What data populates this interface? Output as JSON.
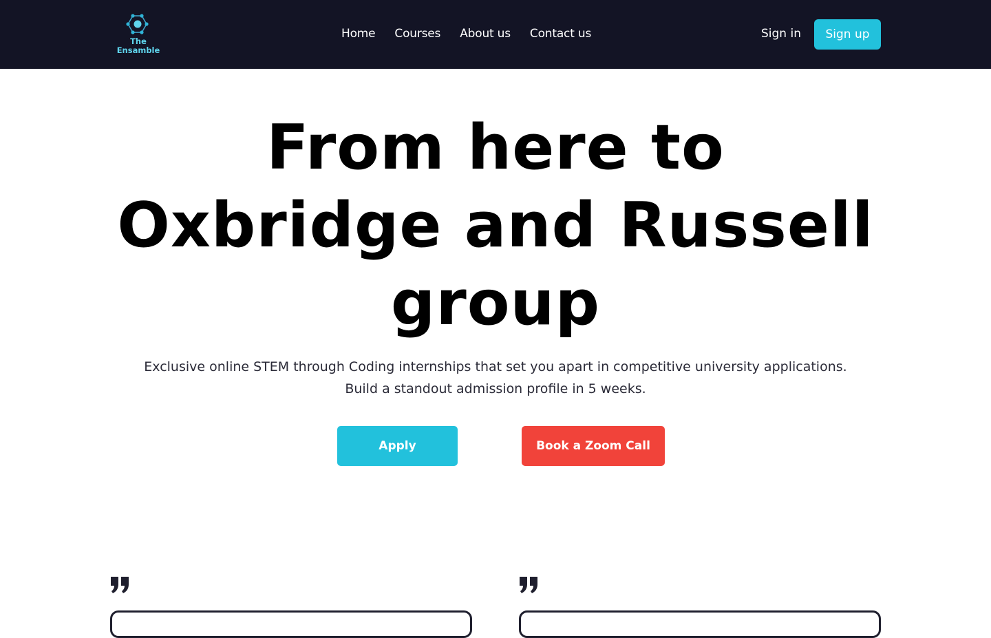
{
  "header": {
    "logo_line1": "The",
    "logo_line2": "Ensamble",
    "nav": [
      {
        "label": "Home"
      },
      {
        "label": "Courses"
      },
      {
        "label": "About us"
      },
      {
        "label": "Contact us"
      }
    ],
    "signin_label": "Sign in",
    "signup_label": "Sign up"
  },
  "hero": {
    "title_line1": "From here to",
    "title_line2": "Oxbridge and Russell",
    "title_line3": "group",
    "subtitle_line1": "Exclusive online STEM through Coding internships that set you apart in competitive university applications.",
    "subtitle_line2": "Build a standout admission profile in 5 weeks.",
    "apply_label": "Apply",
    "zoom_label": "Book a Zoom Call"
  },
  "testimonials": {
    "icon": "quote-icon"
  },
  "colors": {
    "header_bg": "#131425",
    "accent": "#22c1dc",
    "cta_red": "#f1433a",
    "logo": "#5fd4ec"
  }
}
